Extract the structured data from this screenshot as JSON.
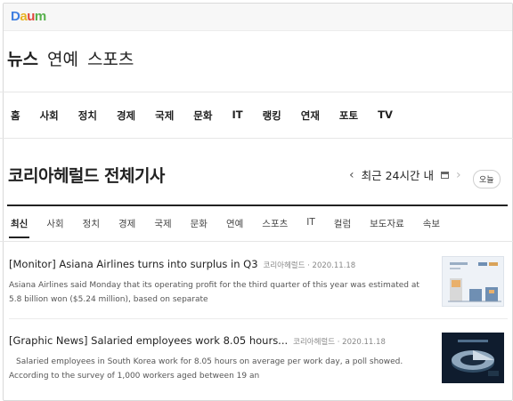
{
  "logo": {
    "p1": "D",
    "p2": "a",
    "p3": "u",
    "p4": "m"
  },
  "sections": [
    "뉴스",
    "연예",
    "스포츠"
  ],
  "categories": [
    "홈",
    "사회",
    "정치",
    "경제",
    "국제",
    "문화",
    "IT",
    "랭킹",
    "연재",
    "포토",
    "TV"
  ],
  "page_title": "코리아헤럴드 전체기사",
  "date_nav": {
    "label": "최근 24시간 내",
    "prev": "‹",
    "next": "›",
    "today": "오늘"
  },
  "subtabs": [
    "최신",
    "사회",
    "정치",
    "경제",
    "국제",
    "문화",
    "연예",
    "스포츠",
    "IT",
    "컬럼",
    "보도자료",
    "속보"
  ],
  "articles": [
    {
      "title": "[Monitor] Asiana Airlines turns into surplus in Q3",
      "source": "코리아헤럴드 · 2020.11.18",
      "summary1": "Asiana Airlines said Monday that its operating profit for the third quarter of this year was estimated at",
      "summary2": "5.8 billion won ($5.24 million), based on separate"
    },
    {
      "title": "[Graphic News] Salaried employees work 8.05 hours...",
      "source": "코리아헤럴드 · 2020.11.18",
      "summary1": "Salaried employees in South Korea work for 8.05 hours on average per work day, a poll showed.",
      "summary2": "According to the survey of 1,000 workers aged between 19 an"
    }
  ]
}
